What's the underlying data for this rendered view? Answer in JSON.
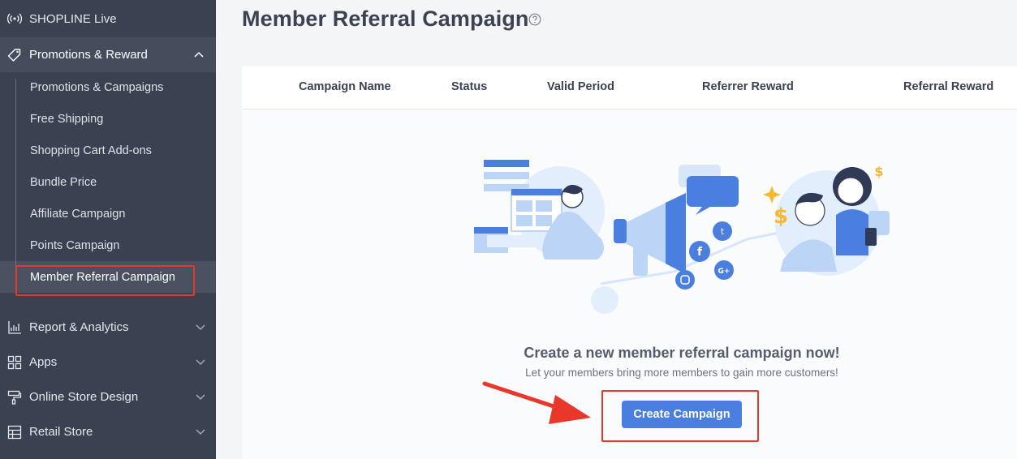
{
  "sidebar": {
    "top_item": {
      "label": "SHOPLINE Live",
      "icon": "broadcast-icon"
    },
    "section": {
      "label": "Promotions & Reward",
      "icon": "tag-icon",
      "expanded": true
    },
    "sub_items": [
      {
        "label": "Promotions & Campaigns"
      },
      {
        "label": "Free Shipping"
      },
      {
        "label": "Shopping Cart Add-ons"
      },
      {
        "label": "Bundle Price"
      },
      {
        "label": "Affiliate Campaign"
      },
      {
        "label": "Points Campaign"
      },
      {
        "label": "Member Referral Campaign",
        "active": true
      }
    ],
    "items": [
      {
        "label": "Report & Analytics",
        "icon": "chart-icon"
      },
      {
        "label": "Apps",
        "icon": "apps-grid-icon"
      },
      {
        "label": "Online Store Design",
        "icon": "paint-roller-icon"
      },
      {
        "label": "Retail Store",
        "icon": "store-icon"
      }
    ]
  },
  "main": {
    "title": "Member Referral Campaign",
    "table": {
      "columns": [
        "Campaign Name",
        "Status",
        "Valid Period",
        "Referrer Reward",
        "Referral Reward"
      ]
    },
    "empty_state": {
      "title": "Create a new member referral campaign now!",
      "subtitle": "Let your members bring more members to gain more customers!",
      "button_label": "Create Campaign"
    }
  },
  "colors": {
    "sidebar_bg": "#3a4150",
    "primary_button": "#4a7fe0",
    "highlight_red": "#e8382b"
  }
}
